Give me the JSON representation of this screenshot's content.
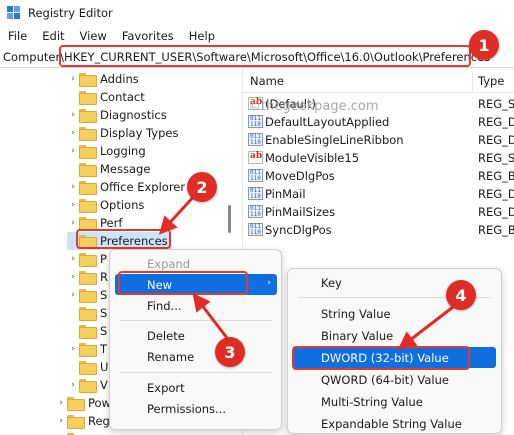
{
  "window": {
    "title": "Registry Editor"
  },
  "menu": [
    "File",
    "Edit",
    "View",
    "Favorites",
    "Help"
  ],
  "address": {
    "label": "Computer\\",
    "path": "HKEY_CURRENT_USER\\Software\\Microsoft\\Office\\16.0\\Outlook\\Preferences"
  },
  "tree": [
    {
      "label": "Addins",
      "chev": "›"
    },
    {
      "label": "Contact",
      "chev": ""
    },
    {
      "label": "Diagnostics",
      "chev": "›"
    },
    {
      "label": "Display Types",
      "chev": "›"
    },
    {
      "label": "Logging",
      "chev": "›"
    },
    {
      "label": "Message",
      "chev": ""
    },
    {
      "label": "Office Explorer",
      "chev": "›"
    },
    {
      "label": "Options",
      "chev": "›"
    },
    {
      "label": "Perf",
      "chev": "›"
    },
    {
      "label": "Preferences",
      "chev": ""
    },
    {
      "label": "P",
      "chev": "›"
    },
    {
      "label": "R",
      "chev": "›"
    },
    {
      "label": "S",
      "chev": "›"
    },
    {
      "label": "S",
      "chev": ""
    },
    {
      "label": "S",
      "chev": ""
    },
    {
      "label": "T",
      "chev": "›"
    },
    {
      "label": "U",
      "chev": ""
    },
    {
      "label": "V",
      "chev": "›"
    },
    {
      "label": "Pow",
      "chev": "›"
    },
    {
      "label": "Regi",
      "chev": "›"
    },
    {
      "label": "",
      "chev": "›"
    }
  ],
  "values_pane": {
    "columns": {
      "name": "Name",
      "type": "Type"
    },
    "rows": [
      {
        "icon": "string-value-icon",
        "name": "(Default)",
        "type": "REG_SZ"
      },
      {
        "icon": "binary-value-icon",
        "name": "DefaultLayoutApplied",
        "type": "REG_DW"
      },
      {
        "icon": "binary-value-icon",
        "name": "EnableSingleLineRibbon",
        "type": "REG_DW"
      },
      {
        "icon": "string-value-icon",
        "name": "ModuleVisible15",
        "type": "REG_SZ"
      },
      {
        "icon": "binary-value-icon",
        "name": "MoveDlgPos",
        "type": "REG_BI"
      },
      {
        "icon": "binary-value-icon",
        "name": "PinMail",
        "type": "REG_DW"
      },
      {
        "icon": "binary-value-icon",
        "name": "PinMailSizes",
        "type": "REG_DW"
      },
      {
        "icon": "binary-value-icon",
        "name": "SyncDlgPos",
        "type": "REG_BI"
      }
    ]
  },
  "context_menu": {
    "items": [
      {
        "label": "Expand",
        "state": "disabled"
      },
      {
        "label": "New",
        "state": "active",
        "submenu": "›"
      },
      {
        "label": "Find...",
        "state": "normal"
      },
      {
        "label": "Delete",
        "state": "normal"
      },
      {
        "label": "Rename",
        "state": "normal"
      },
      {
        "label": "Export",
        "state": "normal"
      },
      {
        "label": "Permissions...",
        "state": "normal"
      }
    ]
  },
  "new_submenu": {
    "items": [
      {
        "label": "Key",
        "state": "normal"
      },
      {
        "label": "String Value",
        "state": "normal"
      },
      {
        "label": "Binary Value",
        "state": "normal"
      },
      {
        "label": "DWORD (32-bit) Value",
        "state": "active"
      },
      {
        "label": "QWORD (64-bit) Value",
        "state": "normal"
      },
      {
        "label": "Multi-String Value",
        "state": "normal"
      },
      {
        "label": "Expandable String Value",
        "state": "normal"
      }
    ]
  },
  "annotations": {
    "step1": "1",
    "step2": "2",
    "step3": "3",
    "step4": "4"
  },
  "watermark": "©thegeekpage.com",
  "colors": {
    "callout": "#e02c24",
    "selection": "#0f6fe0",
    "tree_selection": "#cce4f7"
  }
}
